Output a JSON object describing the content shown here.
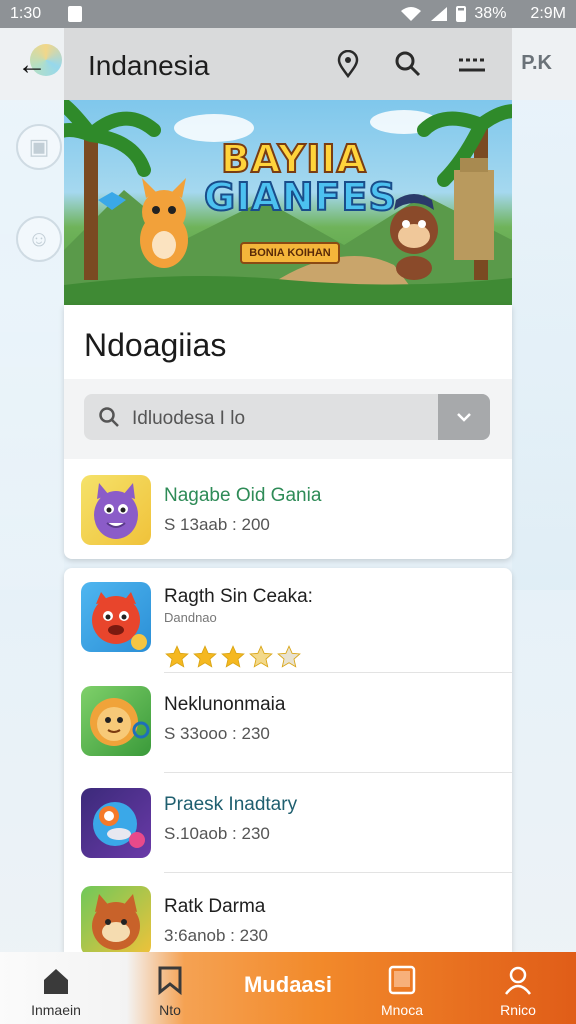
{
  "status_bar": {
    "time_left": "1:30",
    "battery": "38%",
    "time_right": "2:9M"
  },
  "app_bar": {
    "title": "Indanesia",
    "right_label": "P.K"
  },
  "banner": {
    "title_line1": "BAYIIA",
    "title_line2": "GIANFES",
    "subtitle": "BONIA KOIHAN"
  },
  "section": {
    "title": "Ndoagiias"
  },
  "search": {
    "value": "Idluodesa I lo"
  },
  "featured_game": {
    "name": "Nagabe Oid Gania",
    "meta": "S 13aab : 200"
  },
  "games": [
    {
      "name": "Ragth Sin Ceaka:",
      "sub": "Dandnao",
      "rating": 3.5
    },
    {
      "name": "Neklunonmaia",
      "meta": "S 33ooo : 230"
    },
    {
      "name": "Praesk Inadtary",
      "meta": "S.10aob : 230"
    },
    {
      "name": "Ratk Darma",
      "meta": "3:6anob : 230"
    }
  ],
  "bottom_nav": {
    "items": [
      {
        "label": "Inmaein",
        "icon": "home-icon"
      },
      {
        "label": "Nto",
        "icon": "bookmark-icon"
      },
      {
        "label": "Mnoca",
        "icon": "tablet-icon"
      },
      {
        "label": "Rnico",
        "icon": "person-icon"
      }
    ],
    "center_label": "Mudaasi"
  },
  "colors": {
    "accent": "#f28a2b",
    "star": "#f5b820",
    "link_green": "#2e8b57"
  }
}
